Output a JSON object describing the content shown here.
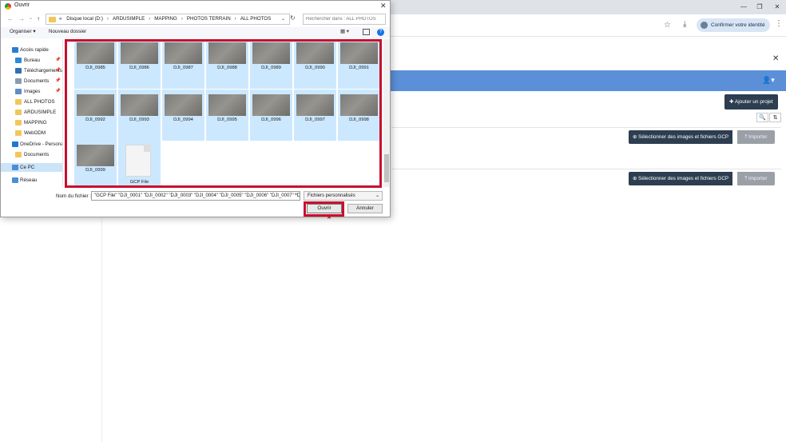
{
  "browser": {
    "identity_label": "Confirmer votre identité",
    "minimize": "—",
    "restore": "❐",
    "close": "✕",
    "star": "☆",
    "download": "⤓",
    "menu": "⋮",
    "page_close": "✕"
  },
  "webapp": {
    "add_project_label": "Ajouter un projet",
    "add_prefix": "✚ ",
    "search_glyph": "🔍",
    "sort_glyph": "⇅",
    "user_glyph": "👤▾",
    "projects": [
      {
        "select_label": "⊕ Sélectionner des images et fichiers GCP",
        "import_label": "⤒ Importer"
      },
      {
        "select_label": "⊕ Sélectionner des images et fichiers GCP",
        "import_label": "⤒ Importer"
      }
    ]
  },
  "dialog": {
    "title": "Ouvrir",
    "close": "✕",
    "nav_back": "←",
    "nav_forward": "→",
    "nav_down": "⌄",
    "nav_up": "↑",
    "breadcrumb_lead": "«",
    "breadcrumb": [
      "Disque local (D:)",
      "ARDUSIMPLE",
      "MAPPING",
      "PHOTOS TERRAIN",
      "ALL PHOTOS"
    ],
    "breadcrumb_sep": "›",
    "dropdown": "⌄",
    "refresh": "↻",
    "search_placeholder": "Rechercher dans : ALL PHOTOS",
    "organize_label": "Organiser ▾",
    "new_folder_label": "Nouveau dossier",
    "view_label": "▦ ▾",
    "help_label": "?",
    "nav_items": [
      {
        "label": "Accès rapide",
        "color": "#2b7bd6",
        "pinned": false,
        "top": true
      },
      {
        "label": "Bureau",
        "color": "#2f89d9",
        "pinned": true,
        "top": false
      },
      {
        "label": "Téléchargements",
        "color": "#2f6fb8",
        "pinned": true,
        "top": false
      },
      {
        "label": "Documents",
        "color": "#8a9bb0",
        "pinned": true,
        "top": false
      },
      {
        "label": "Images",
        "color": "#5a8fc8",
        "pinned": true,
        "top": false
      },
      {
        "label": "ALL PHOTOS",
        "color": "#f1c75b",
        "pinned": false,
        "top": false
      },
      {
        "label": "ARDUSIMPLE",
        "color": "#f1c75b",
        "pinned": false,
        "top": false
      },
      {
        "label": "MAPPING",
        "color": "#f1c75b",
        "pinned": false,
        "top": false
      },
      {
        "label": "WebODM",
        "color": "#f1c75b",
        "pinned": false,
        "top": false
      },
      {
        "label": "OneDrive - Personal",
        "color": "#1f78d1",
        "pinned": false,
        "top": true
      },
      {
        "label": "Documents",
        "color": "#f1c75b",
        "pinned": false,
        "top": false
      },
      {
        "label": "Ce PC",
        "color": "#4a8fd6",
        "pinned": false,
        "top": true
      },
      {
        "label": "Réseau",
        "color": "#4a8fd6",
        "pinned": false,
        "top": true
      }
    ],
    "pin_glyph": "📌",
    "files": [
      {
        "name": "DJI_0985",
        "type": "image"
      },
      {
        "name": "DJI_0986",
        "type": "image"
      },
      {
        "name": "DJI_0987",
        "type": "image"
      },
      {
        "name": "DJI_0988",
        "type": "image"
      },
      {
        "name": "DJI_0989",
        "type": "image"
      },
      {
        "name": "DJI_0990",
        "type": "image"
      },
      {
        "name": "DJI_0991",
        "type": "image"
      },
      {
        "name": "DJI_0992",
        "type": "image"
      },
      {
        "name": "DJI_0993",
        "type": "image"
      },
      {
        "name": "DJI_0994",
        "type": "image"
      },
      {
        "name": "DJI_0995",
        "type": "image"
      },
      {
        "name": "DJI_0996",
        "type": "image"
      },
      {
        "name": "DJI_0997",
        "type": "image"
      },
      {
        "name": "DJI_0998",
        "type": "image"
      },
      {
        "name": "DJI_0999",
        "type": "image"
      },
      {
        "name": "GCP File",
        "type": "doc"
      }
    ],
    "filename_label": "Nom du fichier :",
    "filename_value": "\"GCP File\" \"DJI_0001\" \"DJI_0002\" \"DJI_0003\" \"DJI_0004\" \"DJI_0005\" \"DJI_0006\" \"DJI_0007\" \"DJI_",
    "filetype_label": "Fichiers personnalisés",
    "open_label": "Ouvrir",
    "cancel_label": "Annuler"
  },
  "colors": {
    "navbar": "#5b8fd8",
    "highlight": "#c8102e",
    "dark_button": "#2c3e50"
  }
}
